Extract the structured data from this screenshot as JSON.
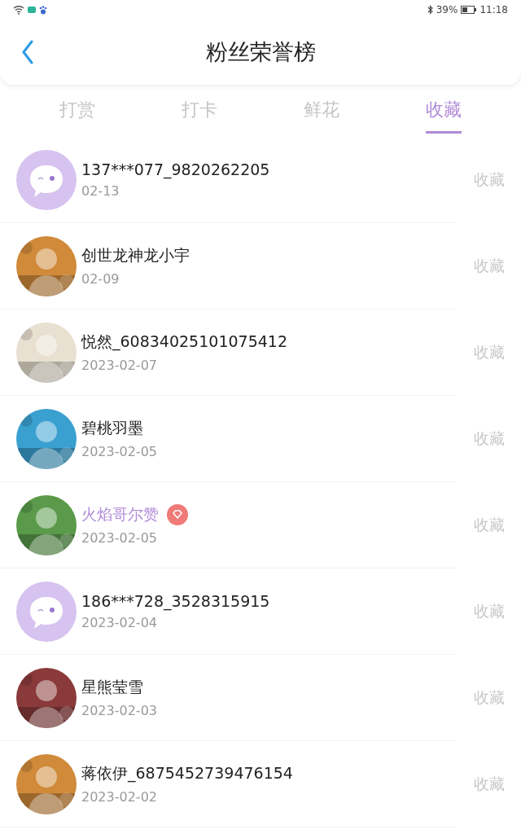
{
  "status_bar": {
    "battery_text": "39%",
    "time": "11:18"
  },
  "header": {
    "title": "粉丝荣誉榜"
  },
  "tabs": [
    {
      "label": "打赏",
      "selected": false
    },
    {
      "label": "打卡",
      "selected": false
    },
    {
      "label": "鲜花",
      "selected": false
    },
    {
      "label": "收藏",
      "selected": true
    }
  ],
  "fans": [
    {
      "kind": "default",
      "name": "137***077_9820262205",
      "vip": false,
      "date": "02-13",
      "action": "收藏"
    },
    {
      "kind": "picture",
      "name": "创世龙神龙小宇",
      "vip": false,
      "date": "02-09",
      "action": "收藏"
    },
    {
      "kind": "picture",
      "name": "悦然_60834025101075412",
      "vip": false,
      "date": "2023-02-07",
      "action": "收藏"
    },
    {
      "kind": "picture",
      "name": "碧桃羽墨",
      "vip": false,
      "date": "2023-02-05",
      "action": "收藏"
    },
    {
      "kind": "picture",
      "name": "火焰哥尔赞",
      "vip": true,
      "date": "2023-02-05",
      "action": "收藏"
    },
    {
      "kind": "default",
      "name": "186***728_3528315915",
      "vip": false,
      "date": "2023-02-04",
      "action": "收藏"
    },
    {
      "kind": "picture",
      "name": "星熊莹雪",
      "vip": false,
      "date": "2023-02-03",
      "action": "收藏"
    },
    {
      "kind": "picture",
      "name": "蒋依伊_6875452739476154",
      "vip": false,
      "date": "2023-02-02",
      "action": "收藏"
    }
  ]
}
